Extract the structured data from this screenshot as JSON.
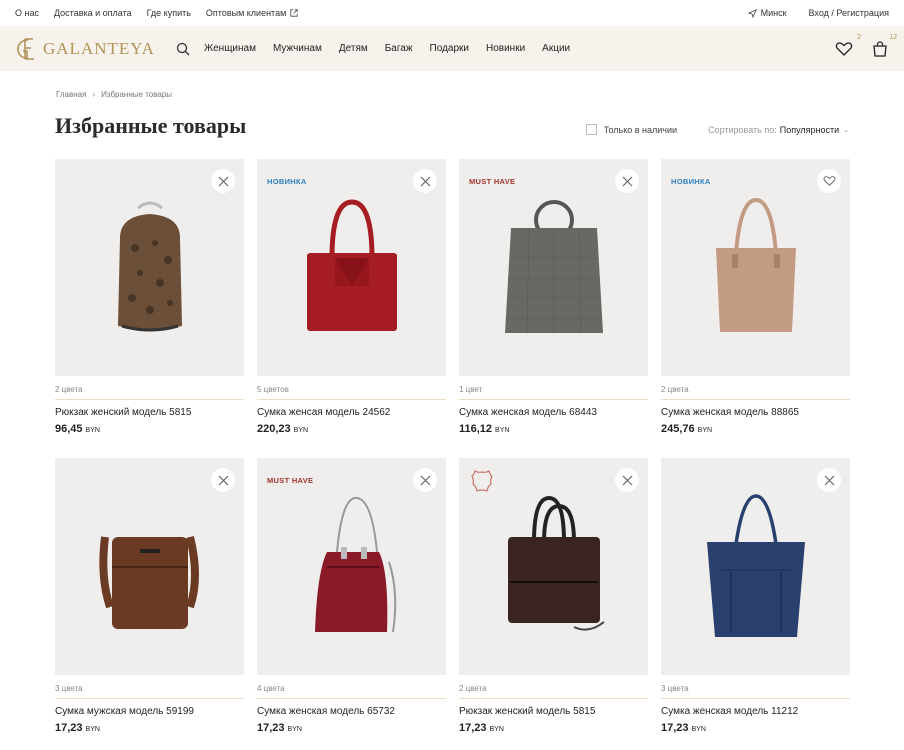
{
  "topbar": {
    "links": [
      "О нас",
      "Доставка и оплата",
      "Где купить",
      "Оптовым клиентам"
    ],
    "city": "Минск",
    "auth": "Вход / Регистрация"
  },
  "header": {
    "brand": "GALANTEYA",
    "nav": [
      "Женщинам",
      "Мужчинам",
      "Детям",
      "Багаж",
      "Подарки",
      "Новинки",
      "Акции"
    ],
    "favorites_count": "2",
    "cart_count": "12"
  },
  "breadcrumb": {
    "home": "Главная",
    "separator": "›",
    "current": "Избранные товары"
  },
  "page_title": "Избранные товары",
  "filters": {
    "in_stock_label": "Только в наличии",
    "sort_label": "Сортировать по:",
    "sort_value": "Популярности"
  },
  "products": [
    {
      "badge": "",
      "colors": "2 цвета",
      "name": "Рюкзак женский модель 5815",
      "price": "96,45",
      "currency": "BYN",
      "action": "remove",
      "color": "#6b4f38"
    },
    {
      "badge": "НОВИНКА",
      "colors": "5 цветов",
      "name": "Сумка женсая модель 24562",
      "price": "220,23",
      "currency": "BYN",
      "action": "remove",
      "color": "#a51d22"
    },
    {
      "badge": "MUST HAVE",
      "colors": "1 цвет",
      "name": "Сумка женская модель 68443",
      "price": "116,12",
      "currency": "BYN",
      "action": "remove",
      "color": "#6a6864"
    },
    {
      "badge": "НОВИНКА",
      "colors": "2 цвета",
      "name": "Сумка женская модель 88865",
      "price": "245,76",
      "currency": "BYN",
      "action": "favorite",
      "color": "#c39a82"
    },
    {
      "badge": "",
      "colors": "3 цвета",
      "name": "Сумка мужская модель 59199",
      "price": "17,23",
      "currency": "BYN",
      "action": "remove",
      "color": "#6a3a22"
    },
    {
      "badge": "MUST HAVE",
      "colors": "4 цвета",
      "name": "Сумка женская модель 65732",
      "price": "17,23",
      "currency": "BYN",
      "action": "remove",
      "color": "#8b1a28"
    },
    {
      "badge": "",
      "colors": "2 цвета",
      "name": "Рюкзак женский модель 5815",
      "price": "17,23",
      "currency": "BYN",
      "action": "remove",
      "color": "#3a2422",
      "leather": true
    },
    {
      "badge": "",
      "colors": "3 цвета",
      "name": "Сумка женская модель 11212",
      "price": "17,23",
      "currency": "BYN",
      "action": "remove",
      "color": "#2a4170"
    }
  ],
  "colors": {
    "accent": "#b2935a",
    "header_bg": "#f7f3ec",
    "new_badge": "#2f7fc1",
    "must_badge": "#a2352d"
  }
}
